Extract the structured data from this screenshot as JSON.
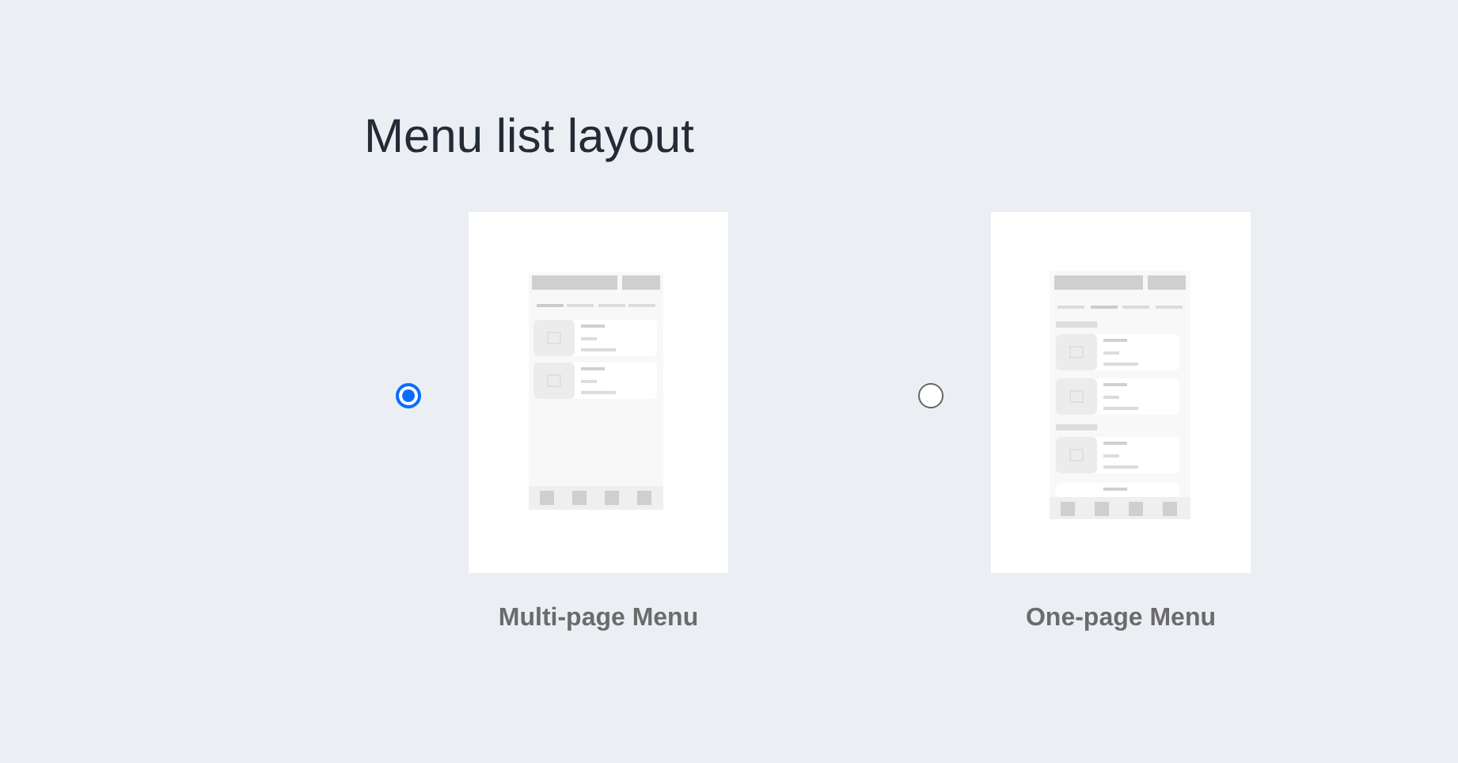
{
  "title": "Menu list layout",
  "options": [
    {
      "kind": "multi",
      "label": "Multi-page Menu",
      "selected": true
    },
    {
      "kind": "single",
      "label": "One-page Menu",
      "selected": false
    }
  ]
}
